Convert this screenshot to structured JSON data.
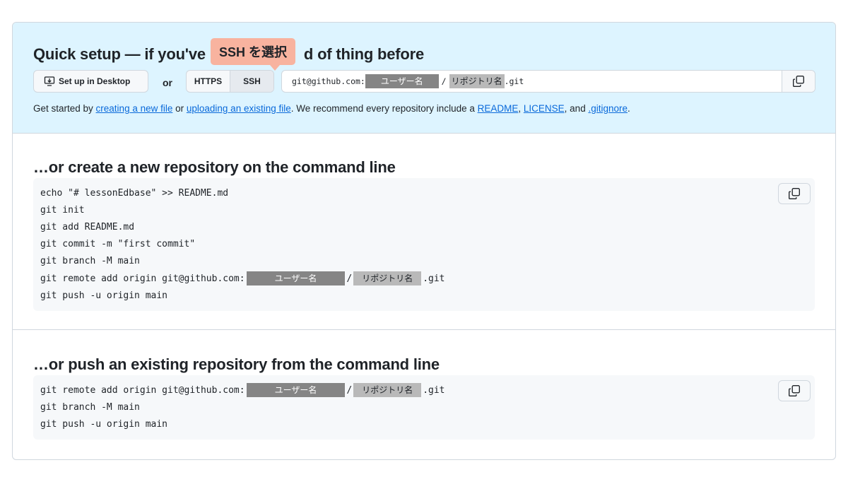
{
  "quick_setup": {
    "title": "Quick setup — if you've done this kind of thing before",
    "title_left": "Quick setup — if you've",
    "title_right": "d of thing before",
    "tooltip": "SSH を選択",
    "desktop_button": "Set up in Desktop",
    "or_label": "or",
    "protocols": [
      "HTTPS",
      "SSH"
    ],
    "selected_protocol": "SSH",
    "url": {
      "prefix": "git@github.com:",
      "user_mask": "ユーザー名",
      "slash": "/",
      "repo_mask": "リポジトリ名",
      "suffix": ".git"
    },
    "description": {
      "t1": "Get started by ",
      "link1": "creating a new file",
      "t2": " or ",
      "link2": "uploading an existing file",
      "t3": ". We recommend every repository include a ",
      "link3": "README",
      "t4": ", ",
      "link4": "LICENSE",
      "t5": ", and ",
      "link5": ".gitignore",
      "t6": "."
    }
  },
  "create_section": {
    "title": "…or create a new repository on the command line",
    "lines": [
      "echo \"# lessonEdbase\" >> README.md",
      "git init",
      "git add README.md",
      "git commit -m \"first commit\"",
      "git branch -M main"
    ],
    "remote_line": {
      "prefix": "git remote add origin git@github.com:",
      "user_mask": "ユーザー名",
      "slash": "/",
      "repo_mask": "リポジトリ名",
      "suffix": ".git"
    },
    "last_line": "git push -u origin main"
  },
  "push_section": {
    "title": "…or push an existing repository from the command line",
    "remote_line": {
      "prefix": "git remote add origin git@github.com:",
      "user_mask": "ユーザー名",
      "slash": "/",
      "repo_mask": "リポジトリ名",
      "suffix": ".git"
    },
    "lines": [
      "git branch -M main",
      "git push -u origin main"
    ]
  },
  "icons": {
    "desktop": "desktop-download-icon",
    "copy": "copy-icon"
  },
  "colors": {
    "quick_bg": "#ddf4ff",
    "link": "#0969da",
    "tooltip": "#f8b39f",
    "mask_dark": "#858585",
    "mask_light": "#b9b9b9"
  }
}
